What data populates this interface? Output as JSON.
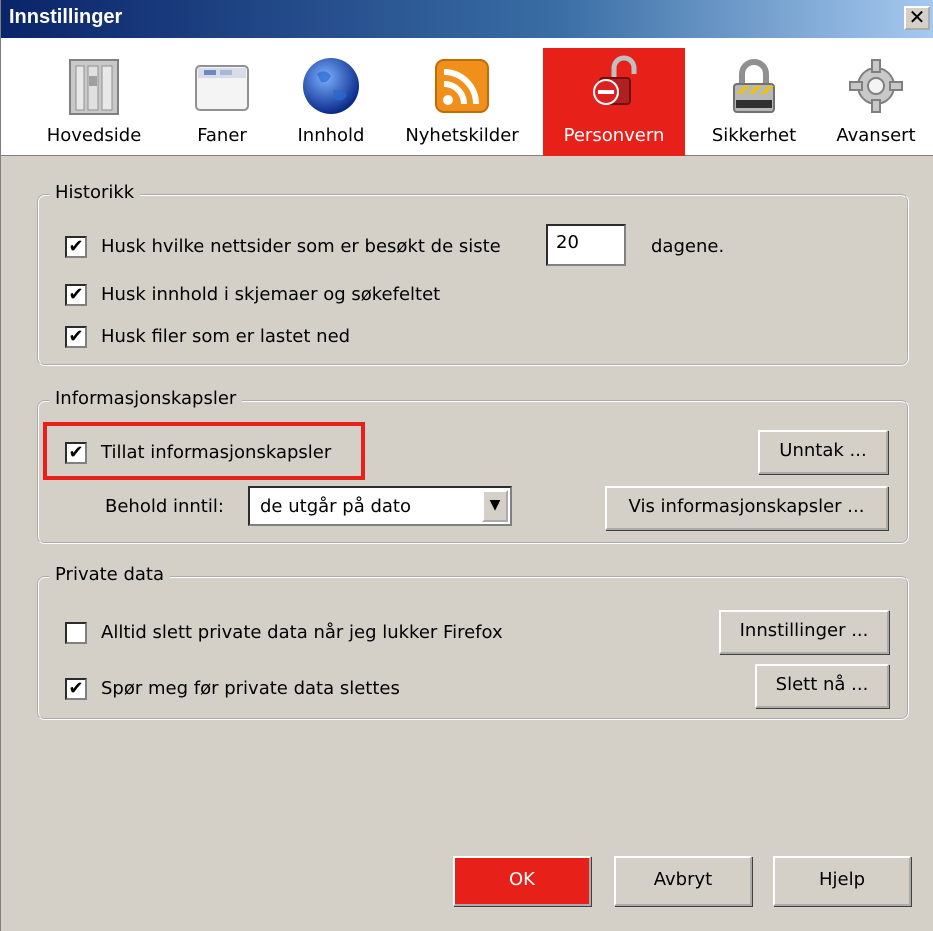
{
  "window": {
    "title": "Innstillinger",
    "close_glyph": "✕"
  },
  "toolbar": {
    "tabs": [
      {
        "label": "Hovedside",
        "icon": "main-page-icon"
      },
      {
        "label": "Faner",
        "icon": "tabs-icon"
      },
      {
        "label": "Innhold",
        "icon": "content-globe-icon"
      },
      {
        "label": "Nyhetskilder",
        "icon": "feeds-icon"
      },
      {
        "label": "Personvern",
        "icon": "privacy-lock-icon",
        "selected": true
      },
      {
        "label": "Sikkerhet",
        "icon": "security-padlock-icon"
      },
      {
        "label": "Avansert",
        "icon": "advanced-gear-icon"
      }
    ],
    "selected_color": "#e8201a"
  },
  "history": {
    "legend": "Historikk",
    "visited_pre": "Husk hvilke nettsider som er besøkt de siste",
    "visited_days": "20",
    "visited_post": "dagene.",
    "forms": "Husk innhold i skjemaer og søkefeltet",
    "downloads": "Husk filer som er lastet ned"
  },
  "cookies": {
    "legend": "Informasjonskapsler",
    "allow": "Tillat informasjonskapsler",
    "keep_label": "Behold inntil:",
    "keep_value": "de utgår på dato",
    "exceptions_button": "Unntak ...",
    "show_button": "Vis informasjonskapsler ..."
  },
  "private": {
    "legend": "Private data",
    "always_clear": "Alltid slett private data når jeg lukker Firefox",
    "ask": "Spør meg før private data slettes",
    "settings_button": "Innstillinger ...",
    "clear_now_button": "Slett nå ..."
  },
  "footer": {
    "ok": "OK",
    "cancel": "Avbryt",
    "help": "Hjelp"
  },
  "checkbox_checked_glyph": "✔"
}
